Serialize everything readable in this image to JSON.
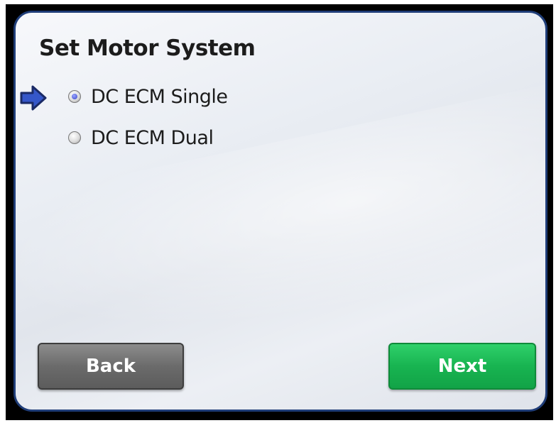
{
  "screen": {
    "title": "Set Motor System"
  },
  "options": [
    {
      "label": "DC ECM Single",
      "selected": true
    },
    {
      "label": "DC ECM Dual",
      "selected": false
    }
  ],
  "indicator": {
    "icon": "right-arrow-icon",
    "color": "#1f3d78"
  },
  "buttons": {
    "back_label": "Back",
    "next_label": "Next"
  },
  "colors": {
    "border": "#1f3d78",
    "next_button": "#18b451",
    "back_button": "#6b6b6b",
    "radio_selected_dot": "#3a44c8"
  }
}
